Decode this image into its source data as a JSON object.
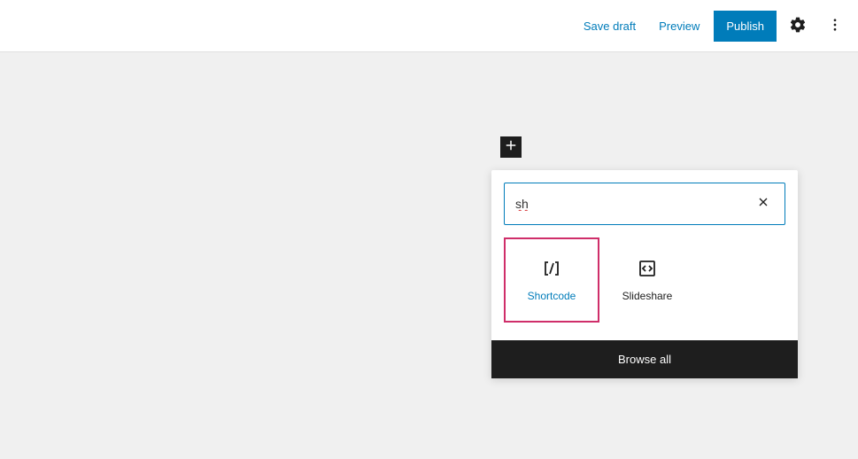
{
  "topbar": {
    "save_draft": "Save draft",
    "preview": "Preview",
    "publish": "Publish"
  },
  "inserter": {
    "search_value": "sh",
    "blocks": [
      {
        "label": "Shortcode",
        "icon": "shortcode",
        "selected": true
      },
      {
        "label": "Slideshare",
        "icon": "embed",
        "selected": false
      }
    ],
    "browse_all": "Browse all"
  }
}
